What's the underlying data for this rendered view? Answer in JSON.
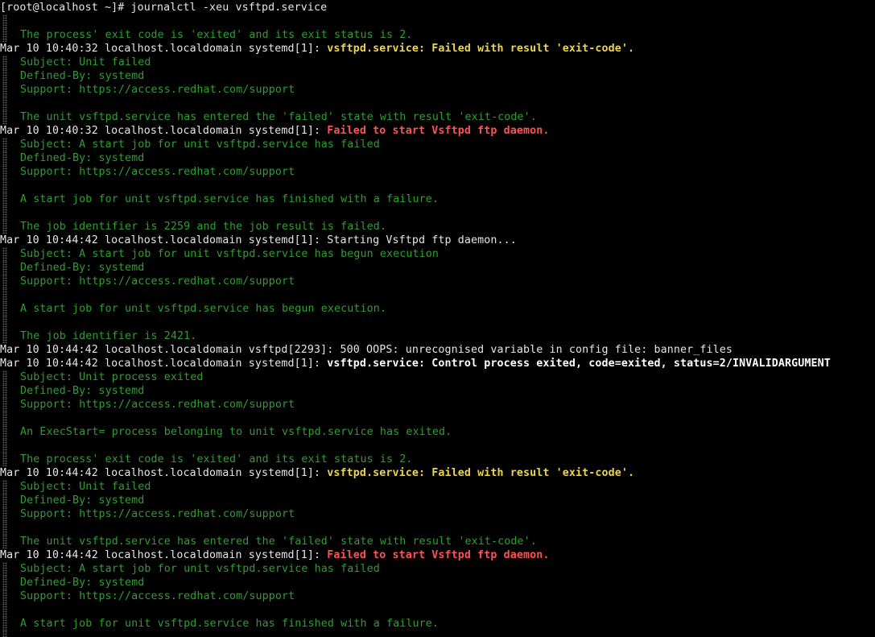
{
  "window": {
    "prompt": "[root@localhost ~]# ",
    "command": "journalctl -xeu vsftpd.service"
  },
  "lines": [
    {
      "type": "meta",
      "text": ""
    },
    {
      "type": "meta",
      "text": "The process' exit code is 'exited' and its exit status is 2."
    },
    {
      "type": "log",
      "prefix": "Mar 10 10:40:32 localhost.localdomain systemd[1]: ",
      "msg": "vsftpd.service: Failed with result 'exit-code'.",
      "style": "yellow"
    },
    {
      "type": "meta",
      "text": "Subject: Unit failed"
    },
    {
      "type": "meta",
      "text": "Defined-By: systemd"
    },
    {
      "type": "meta",
      "text": "Support: https://access.redhat.com/support"
    },
    {
      "type": "meta",
      "text": ""
    },
    {
      "type": "meta",
      "text": "The unit vsftpd.service has entered the 'failed' state with result 'exit-code'."
    },
    {
      "type": "log",
      "prefix": "Mar 10 10:40:32 localhost.localdomain systemd[1]: ",
      "msg": "Failed to start Vsftpd ftp daemon.",
      "style": "red"
    },
    {
      "type": "meta",
      "text": "Subject: A start job for unit vsftpd.service has failed"
    },
    {
      "type": "meta",
      "text": "Defined-By: systemd"
    },
    {
      "type": "meta",
      "text": "Support: https://access.redhat.com/support"
    },
    {
      "type": "meta",
      "text": ""
    },
    {
      "type": "meta",
      "text": "A start job for unit vsftpd.service has finished with a failure."
    },
    {
      "type": "meta",
      "text": ""
    },
    {
      "type": "meta",
      "text": "The job identifier is 2259 and the job result is failed."
    },
    {
      "type": "log",
      "prefix": "Mar 10 10:44:42 localhost.localdomain systemd[1]: ",
      "msg": "Starting Vsftpd ftp daemon...",
      "style": "plain"
    },
    {
      "type": "meta",
      "text": "Subject: A start job for unit vsftpd.service has begun execution"
    },
    {
      "type": "meta",
      "text": "Defined-By: systemd"
    },
    {
      "type": "meta",
      "text": "Support: https://access.redhat.com/support"
    },
    {
      "type": "meta",
      "text": ""
    },
    {
      "type": "meta",
      "text": "A start job for unit vsftpd.service has begun execution."
    },
    {
      "type": "meta",
      "text": ""
    },
    {
      "type": "meta",
      "text": "The job identifier is 2421."
    },
    {
      "type": "log",
      "prefix": "Mar 10 10:44:42 localhost.localdomain vsftpd[2293]: ",
      "msg": "500 OOPS: unrecognised variable in config file: banner_files",
      "style": "plain"
    },
    {
      "type": "log",
      "prefix": "Mar 10 10:44:42 localhost.localdomain systemd[1]: ",
      "msg": "vsftpd.service: Control process exited, code=exited, status=2/INVALIDARGUMENT",
      "style": "white"
    },
    {
      "type": "meta",
      "text": "Subject: Unit process exited"
    },
    {
      "type": "meta",
      "text": "Defined-By: systemd"
    },
    {
      "type": "meta",
      "text": "Support: https://access.redhat.com/support"
    },
    {
      "type": "meta",
      "text": ""
    },
    {
      "type": "meta",
      "text": "An ExecStart= process belonging to unit vsftpd.service has exited."
    },
    {
      "type": "meta",
      "text": ""
    },
    {
      "type": "meta",
      "text": "The process' exit code is 'exited' and its exit status is 2."
    },
    {
      "type": "log",
      "prefix": "Mar 10 10:44:42 localhost.localdomain systemd[1]: ",
      "msg": "vsftpd.service: Failed with result 'exit-code'.",
      "style": "yellow"
    },
    {
      "type": "meta",
      "text": "Subject: Unit failed"
    },
    {
      "type": "meta",
      "text": "Defined-By: systemd"
    },
    {
      "type": "meta",
      "text": "Support: https://access.redhat.com/support"
    },
    {
      "type": "meta",
      "text": ""
    },
    {
      "type": "meta",
      "text": "The unit vsftpd.service has entered the 'failed' state with result 'exit-code'."
    },
    {
      "type": "log",
      "prefix": "Mar 10 10:44:42 localhost.localdomain systemd[1]: ",
      "msg": "Failed to start Vsftpd ftp daemon.",
      "style": "red"
    },
    {
      "type": "meta",
      "text": "Subject: A start job for unit vsftpd.service has failed"
    },
    {
      "type": "meta",
      "text": "Defined-By: systemd"
    },
    {
      "type": "meta",
      "text": "Support: https://access.redhat.com/support"
    },
    {
      "type": "meta",
      "text": ""
    },
    {
      "type": "meta",
      "text": "A start job for unit vsftpd.service has finished with a failure."
    },
    {
      "type": "meta",
      "text": ""
    }
  ],
  "colors": {
    "background": "#000000",
    "text": "#e6e6e6",
    "metadata": "#2f9e2f",
    "warning": "#ecd44f",
    "error": "#ff5252",
    "emphasis": "#ffffff"
  }
}
